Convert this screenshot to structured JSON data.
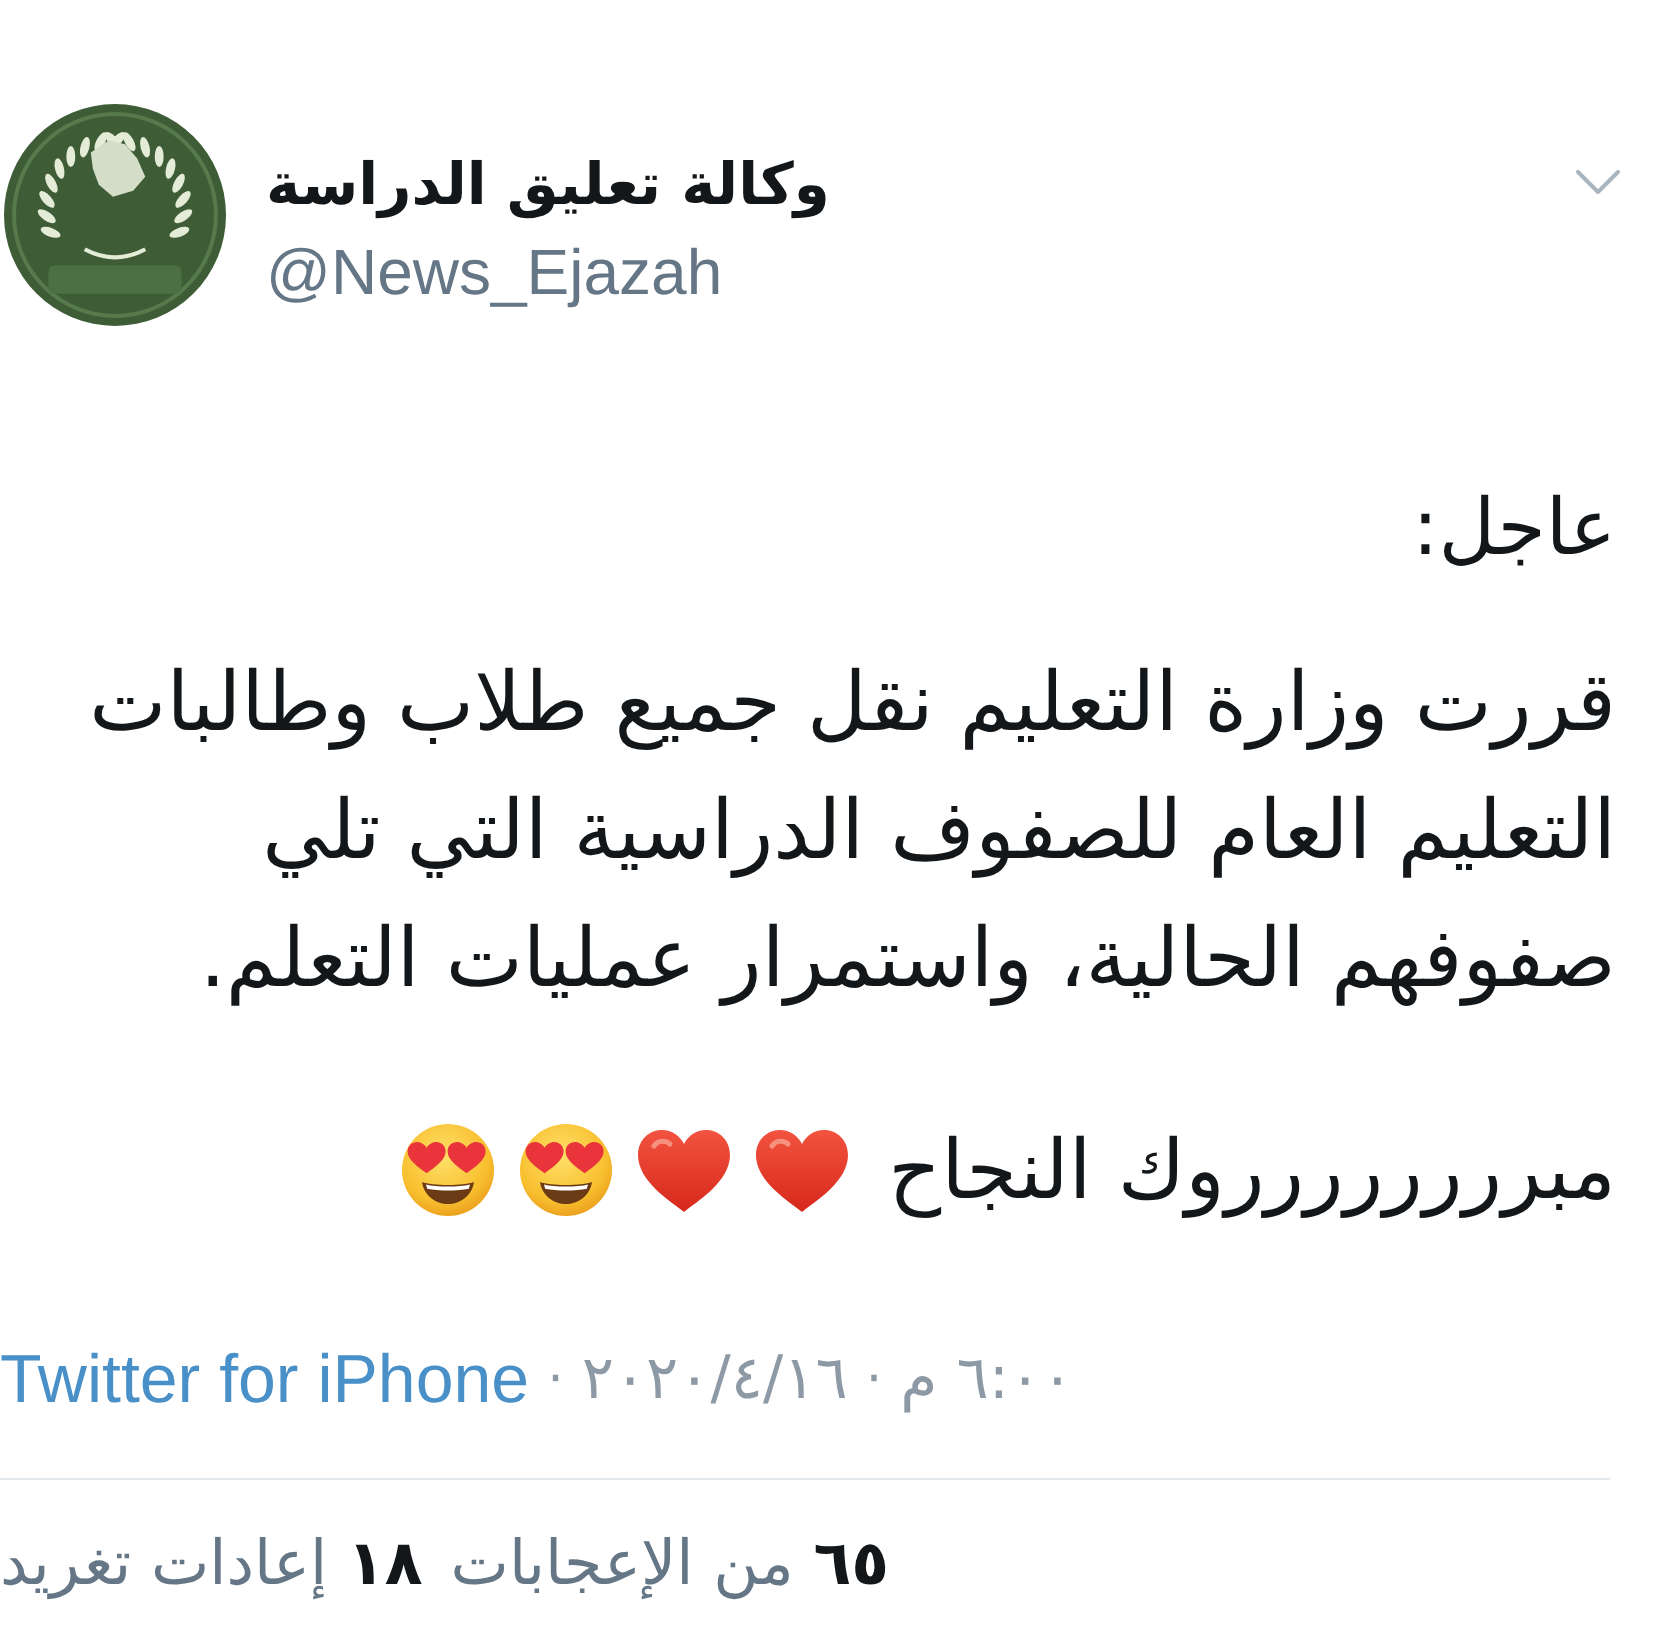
{
  "tweet": {
    "author": {
      "name": "وكالة تعليق الدراسة",
      "handle": "@News_Ejazah"
    },
    "headline": "عاجل:",
    "body": "قررت وزارة التعليم نقل جميع طلاب وطالبات التعليم العام للصفوف الدراسية التي تلي صفوفهم الحالية، واستمرار عمليات التعلم.",
    "closing": {
      "text": "مبرررررررروك النجاح",
      "emojis": [
        {
          "kind": "heart"
        },
        {
          "kind": "heart"
        },
        {
          "kind": "heart_eyes"
        },
        {
          "kind": "heart_eyes"
        }
      ]
    },
    "meta": [
      {
        "kind": "time",
        "text": "٦:٠٠ م"
      },
      {
        "kind": "separator",
        "text": "·"
      },
      {
        "kind": "date",
        "text": "٢٠٢٠/٤/١٦"
      },
      {
        "kind": "separator",
        "text": "·"
      },
      {
        "kind": "source",
        "text": "Twitter for iPhone"
      }
    ],
    "stats": [
      "**٦٥** من الإعجابات",
      "**١٨** إعادات تغريد"
    ]
  }
}
